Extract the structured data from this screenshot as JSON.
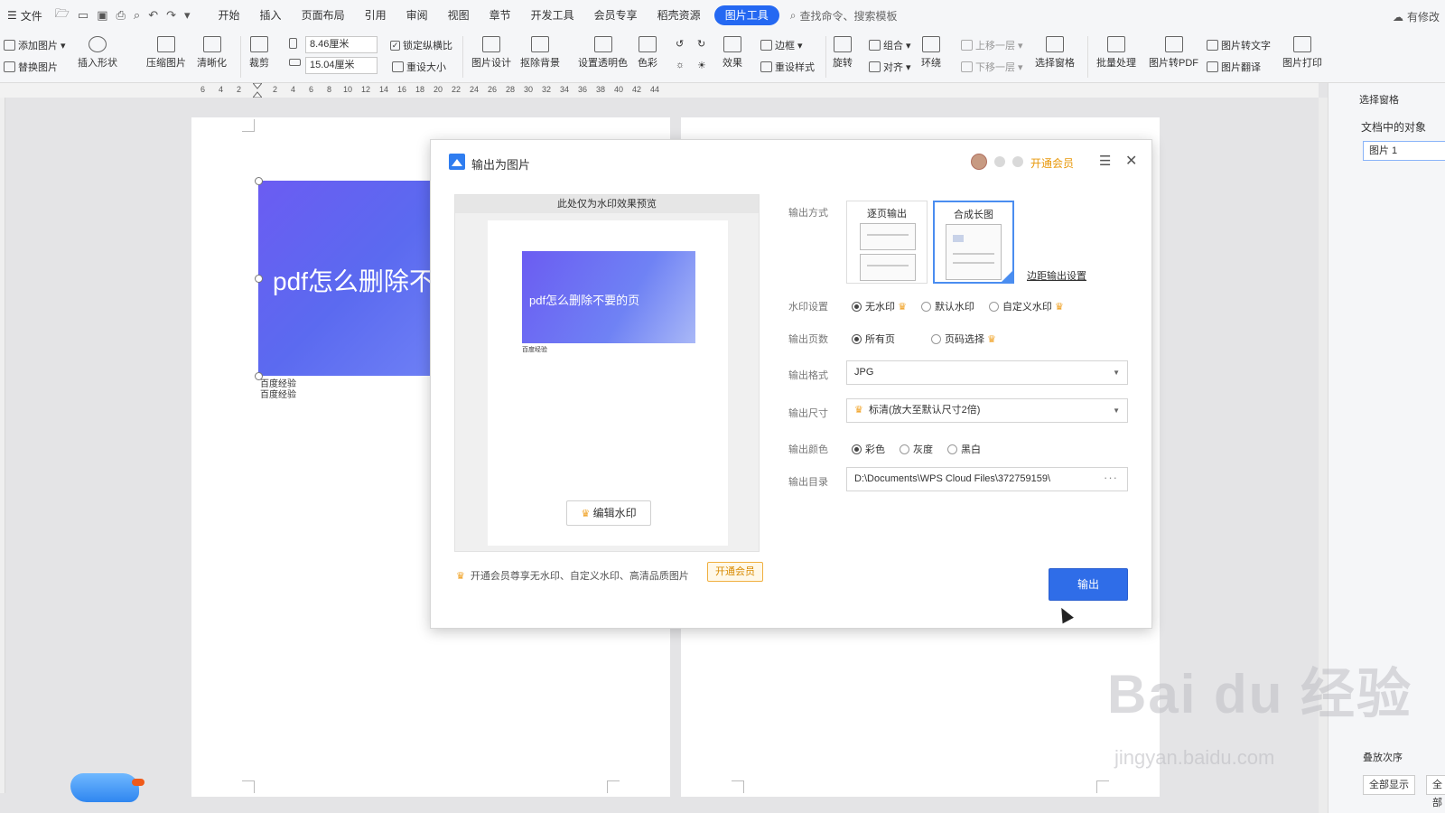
{
  "menubar": {
    "file_label": "文件",
    "tabs": [
      "开始",
      "插入",
      "页面布局",
      "引用",
      "审阅",
      "视图",
      "章节",
      "开发工具",
      "会员专享",
      "稻壳资源"
    ],
    "active_tab": "图片工具",
    "search_placeholder": "查找命令、搜索模板",
    "right_text": "有修改"
  },
  "ribbon": {
    "add_image": "添加图片",
    "replace_image": "替换图片",
    "insert_shape": "插入形状",
    "compress_image": "压缩图片",
    "clarify": "清晰化",
    "crop": "裁剪",
    "height_value": "8.46厘米",
    "width_value": "15.04厘米",
    "lock_ratio": "锁定纵横比",
    "reset_size": "重设大小",
    "image_design": "图片设计",
    "remove_bg": "抠除背景",
    "set_transparent": "设置透明色",
    "color": "色彩",
    "border": "边框",
    "effects": "效果",
    "reset_style": "重设样式",
    "rotate": "旋转",
    "group": "组合",
    "align": "对齐",
    "wrap": "环绕",
    "bring_forward": "上移一层",
    "send_backward": "下移一层",
    "selection_pane": "选择窗格",
    "batch_process": "批量处理",
    "image_to_pdf": "图片转PDF",
    "image_to_text": "图片转文字",
    "image_translate": "图片翻译",
    "image_print": "图片打印"
  },
  "ruler": {
    "numbers": [
      "6",
      "4",
      "2",
      "2",
      "4",
      "6",
      "8",
      "10",
      "12",
      "14",
      "16",
      "18",
      "20",
      "22",
      "24",
      "26",
      "28",
      "30",
      "32",
      "34",
      "36",
      "38",
      "40",
      "42",
      "44"
    ]
  },
  "document": {
    "image_text": "pdf怎么删除不",
    "caption1": "百度经验",
    "caption2": "百度经验"
  },
  "right_pane": {
    "title": "选择窗格",
    "objects_label": "文档中的对象",
    "item": "图片 1",
    "order_label": "叠放次序",
    "show_all": "全部显示",
    "hide_all": "全部"
  },
  "dialog": {
    "title": "输出为图片",
    "vip_link": "开通会员",
    "preview_caption": "此处仅为水印效果预览",
    "preview_image_text": "pdf怎么删除不要的页",
    "preview_mini_text": "百度经验",
    "edit_watermark": "编辑水印",
    "output_mode_label": "输出方式",
    "mode_page": "逐页输出",
    "mode_long": "合成长图",
    "margin_settings": "边距输出设置",
    "watermark_label": "水印设置",
    "watermark_options": [
      "无水印",
      "默认水印",
      "自定义水印"
    ],
    "pages_label": "输出页数",
    "pages_options": [
      "所有页",
      "页码选择"
    ],
    "format_label": "输出格式",
    "format_value": "JPG",
    "size_label": "输出尺寸",
    "size_value": "标清(放大至默认尺寸2倍)",
    "color_label": "输出颜色",
    "color_options": [
      "彩色",
      "灰度",
      "黑白"
    ],
    "dir_label": "输出目录",
    "dir_value": "D:\\Documents\\WPS Cloud Files\\372759159\\",
    "promo_text": "开通会员尊享无水印、自定义水印、高清品质图片",
    "promo_button": "开通会员",
    "export_button": "输出"
  },
  "watermark": {
    "logo": "Bai du 经验",
    "url": "jingyan.baidu.com"
  }
}
